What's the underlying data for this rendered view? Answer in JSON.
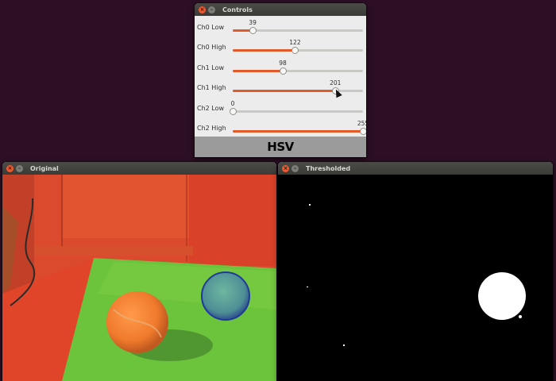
{
  "controls_window": {
    "title": "Controls",
    "panel_text": "HSV",
    "sliders": [
      {
        "label": "Ch0 Low",
        "value": 39,
        "max": 255
      },
      {
        "label": "Ch0 High",
        "value": 122,
        "max": 255
      },
      {
        "label": "Ch1 Low",
        "value": 98,
        "max": 255
      },
      {
        "label": "Ch1 High",
        "value": 201,
        "max": 255
      },
      {
        "label": "Ch2 Low",
        "value": 0,
        "max": 255
      },
      {
        "label": "Ch2 High",
        "value": 255,
        "max": 255
      }
    ]
  },
  "original_window": {
    "title": "Original"
  },
  "thresholded_window": {
    "title": "Thresholded"
  },
  "colors": {
    "desktop": "#2c0f24",
    "slider_fill": "#e05a2a",
    "close_button": "#ee5a2d"
  }
}
